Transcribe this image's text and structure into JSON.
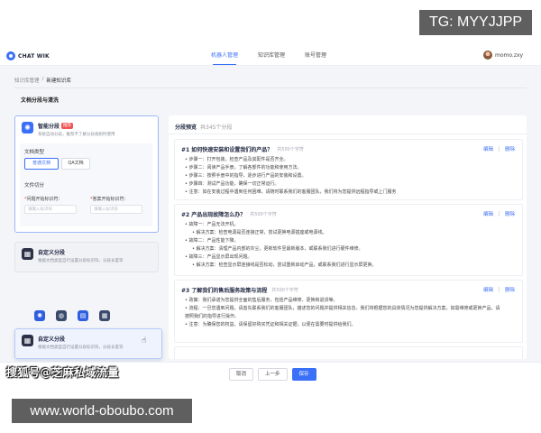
{
  "overlay": {
    "tg_badge": "TG: MYYJJPP",
    "watermark_cn": "搜狐号@芝麻私域流量",
    "url_badge": "www.world-oboubo.com"
  },
  "header": {
    "brand": "CHAT WIK",
    "nav": [
      "机器人管理",
      "知识库管理",
      "账号管理"
    ],
    "active_nav": "机器人管理",
    "user_name": "momo.zxy"
  },
  "breadcrumb": {
    "parent": "知识库管理",
    "separator": "/",
    "current": "新建知识库"
  },
  "section_title": "文档分段与清洗",
  "smart_segment": {
    "title": "智能分段",
    "tag": "推荐",
    "desc": "系统自动分段，推荐不了解分段规则时使用",
    "doc_type_label": "文档类型",
    "doc_types": [
      "普通文档",
      "QA文档"
    ],
    "selected_doc_type": "普通文档",
    "split_label": "文件切分",
    "question_label": "问题开始标识符：",
    "question_placeholder": "请输入标识符",
    "answer_label": "答案开始标识符：",
    "answer_placeholder": "请输入标识符"
  },
  "custom_segment": {
    "title": "自定义分段",
    "desc": "根据文档类型自行设置分段标识符，分段长度等"
  },
  "drag_card": {
    "title": "自定义分段",
    "desc": "根据文档类型自行设置分段标识符，分段长度等"
  },
  "drag_icons": [
    "brain-icon",
    "globe-icon",
    "document-icon",
    "grid-icon"
  ],
  "preview": {
    "title": "分段预览",
    "count": "共345个分段",
    "edit_label": "编辑",
    "delete_label": "删除",
    "segments": [
      {
        "title": "#1 如何快速安装和设置我们的产品？",
        "count": "共500个字符",
        "lines": [
          "• 步骤一：打开包装，检查产品及其配件是否齐全。",
          "• 步骤二：阅读产品手册，了解各部件的功能和使用方法。",
          "• 步骤三：按照手册中的指导，逐步进行产品的安装和设置。",
          "• 步骤四：测试产品功能，确保一切正常运行。",
          "• 注意：如在安装过程中遇到任何困难，请随时联系我们的客服团队，我们将为您提供远程指导或上门服务"
        ]
      },
      {
        "title": "#2 产品出现故障怎么办？",
        "count": "共500个字符",
        "lines": [
          "• 故障一：产品无法开机。",
          "• 解决方案：检查电源是否连接正常，尝试更换电源插座或电源线。",
          "• 故障二：产品性能下降。",
          "• 解决方案：清理产品内部的灰尘，更新软件至最新版本，或联系我们进行硬件维修。",
          "• 故障三：产品显示屏出现问题。",
          "• 解决方案：检查显示屏连接线是否松动，尝试重新启动产品，或联系我们进行显示屏更换。"
        ]
      },
      {
        "title": "#3 了解我们的售后服务政策与流程",
        "count": "共500个字符",
        "lines": [
          "• 政策：我们承诺为您提供全面的售后服务，包括产品维修、更换和退货等。",
          "• 流程：一旦您遇到问题，请首先联系我们的客服团队，描述您的问题并提供相关信息。我们将根据您的具体情况为您提供解决方案，如需维修或更换产品，请按照我们的指导进行操作。",
          "• 注意：为确保您的权益，请保留好购买凭证和相关证据，以便在需要时提供给我们。"
        ]
      }
    ]
  },
  "footer": {
    "cancel": "取消",
    "prev": "上一步",
    "save": "保存"
  }
}
